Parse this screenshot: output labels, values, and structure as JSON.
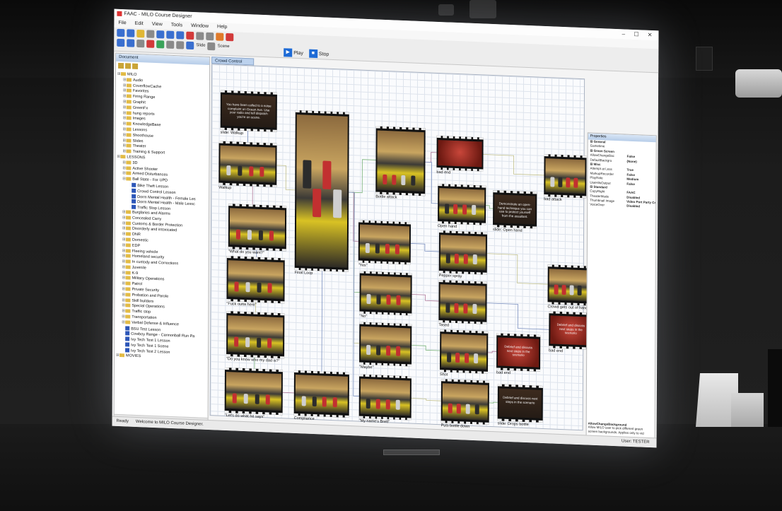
{
  "window": {
    "title": "FAAC - MILO Course Designer",
    "controls": [
      "–",
      "☐",
      "✕"
    ]
  },
  "menu": [
    "File",
    "Edit",
    "View",
    "Tools",
    "Window",
    "Help"
  ],
  "toolbar": {
    "slide_label": "Slide",
    "scene_label": "Scene",
    "play_label": "Play",
    "stop_label": "Stop"
  },
  "document": {
    "header": "Document",
    "tree": [
      {
        "depth": 0,
        "type": "folder",
        "label": "MILO"
      },
      {
        "depth": 1,
        "type": "folder",
        "label": "Audio"
      },
      {
        "depth": 1,
        "type": "folder",
        "label": "CoverflowCache"
      },
      {
        "depth": 1,
        "type": "folder",
        "label": "Favorites"
      },
      {
        "depth": 1,
        "type": "folder",
        "label": "Firing Range"
      },
      {
        "depth": 1,
        "type": "folder",
        "label": "Graphit"
      },
      {
        "depth": 1,
        "type": "folder",
        "label": "GreenFx"
      },
      {
        "depth": 1,
        "type": "folder",
        "label": "hung reports"
      },
      {
        "depth": 1,
        "type": "folder",
        "label": "Images"
      },
      {
        "depth": 1,
        "type": "folder",
        "label": "KnowledgeBase"
      },
      {
        "depth": 1,
        "type": "folder",
        "label": "Lessons"
      },
      {
        "depth": 1,
        "type": "folder",
        "label": "Shoothouse"
      },
      {
        "depth": 1,
        "type": "folder",
        "label": "Slides"
      },
      {
        "depth": 1,
        "type": "folder",
        "label": "Theater"
      },
      {
        "depth": 1,
        "type": "folder",
        "label": "Training & Support"
      },
      {
        "depth": 0,
        "type": "folder",
        "label": "LESSONS"
      },
      {
        "depth": 1,
        "type": "folder",
        "label": "3D"
      },
      {
        "depth": 1,
        "type": "folder",
        "label": "Active Shooter"
      },
      {
        "depth": 1,
        "type": "folder",
        "label": "Armed Disturbances"
      },
      {
        "depth": 1,
        "type": "folder",
        "label": "Ball State - For UPD"
      },
      {
        "depth": 2,
        "type": "lesson",
        "label": "Bike Theft Lesson"
      },
      {
        "depth": 2,
        "type": "lesson",
        "label": "Crowd Control Lesson"
      },
      {
        "depth": 2,
        "type": "lesson",
        "label": "Dorm Mental Health - Female Les"
      },
      {
        "depth": 2,
        "type": "lesson",
        "label": "Dorm Mental Health - Male Lessc"
      },
      {
        "depth": 2,
        "type": "lesson",
        "label": "Traffic Stop Lesson"
      },
      {
        "depth": 1,
        "type": "folder",
        "label": "Burglaries and Alarms"
      },
      {
        "depth": 1,
        "type": "folder",
        "label": "Concealed Carry"
      },
      {
        "depth": 1,
        "type": "folder",
        "label": "Customs & Border Protection"
      },
      {
        "depth": 1,
        "type": "folder",
        "label": "Disorderly and intoxicated"
      },
      {
        "depth": 1,
        "type": "folder",
        "label": "DNR"
      },
      {
        "depth": 1,
        "type": "folder",
        "label": "Domestic"
      },
      {
        "depth": 1,
        "type": "folder",
        "label": "EDP"
      },
      {
        "depth": 1,
        "type": "folder",
        "label": "Fleeing vehicle"
      },
      {
        "depth": 1,
        "type": "folder",
        "label": "Homeland security"
      },
      {
        "depth": 1,
        "type": "folder",
        "label": "In custody and Corrections"
      },
      {
        "depth": 1,
        "type": "folder",
        "label": "Juvenile"
      },
      {
        "depth": 1,
        "type": "folder",
        "label": "K-9"
      },
      {
        "depth": 1,
        "type": "folder",
        "label": "Military Operations"
      },
      {
        "depth": 1,
        "type": "folder",
        "label": "Patrol"
      },
      {
        "depth": 1,
        "type": "folder",
        "label": "Private Security"
      },
      {
        "depth": 1,
        "type": "folder",
        "label": "Probation and Parole"
      },
      {
        "depth": 1,
        "type": "folder",
        "label": "Skill builders"
      },
      {
        "depth": 1,
        "type": "folder",
        "label": "Special Operations"
      },
      {
        "depth": 1,
        "type": "folder",
        "label": "Traffic stop"
      },
      {
        "depth": 1,
        "type": "folder",
        "label": "Transportation"
      },
      {
        "depth": 1,
        "type": "folder",
        "label": "Verbal Defense & Influence"
      },
      {
        "depth": 1,
        "type": "lesson",
        "label": "BSU Test Lesson"
      },
      {
        "depth": 1,
        "type": "lesson",
        "label": "Cowboy Range - Cannonball Run Pa"
      },
      {
        "depth": 1,
        "type": "lesson",
        "label": "Ivy Tech Test 1 Lesson"
      },
      {
        "depth": 1,
        "type": "lesson",
        "label": "Ivy Tech Test 1 Scene"
      },
      {
        "depth": 1,
        "type": "lesson",
        "label": "Ivy Tech Test 2 Lesson"
      },
      {
        "depth": 0,
        "type": "folder",
        "label": "MOVIES"
      }
    ]
  },
  "canvas": {
    "tab": "Crowd Control",
    "nodes": [
      {
        "id": "n1",
        "kind": "slide",
        "caption": "slide: Walkup",
        "text": "You have been called to a noise complaint on Ocean Ave. Use your radio and tell dispatch you're on scene."
      },
      {
        "id": "n2",
        "kind": "video",
        "caption": "Walkup"
      },
      {
        "id": "n3",
        "kind": "tall",
        "caption": "Final Loop"
      },
      {
        "id": "n4",
        "kind": "video",
        "caption": "Bottle attack"
      },
      {
        "id": "n5",
        "kind": "red",
        "caption": "bad end"
      },
      {
        "id": "n6",
        "kind": "video",
        "caption": "bad attack"
      },
      {
        "id": "n7",
        "kind": "video",
        "caption": "Open hand"
      },
      {
        "id": "n8",
        "kind": "slide",
        "caption": "slide: Open hand",
        "text": "Demonstrate an open-hand technique you can use to protect yourself from the assailant."
      },
      {
        "id": "n9",
        "kind": "video",
        "caption": "\"What do you want?\""
      },
      {
        "id": "n10",
        "kind": "video",
        "caption": "\"Yes\""
      },
      {
        "id": "n11",
        "kind": "video",
        "caption": "Pepper spray"
      },
      {
        "id": "n12",
        "kind": "video",
        "caption": "Crowd gets out of hand"
      },
      {
        "id": "n13",
        "kind": "video",
        "caption": "\"Fuck outta here\""
      },
      {
        "id": "n14",
        "kind": "video",
        "caption": "\"No\""
      },
      {
        "id": "n15",
        "kind": "video",
        "caption": "Tased"
      },
      {
        "id": "n16",
        "kind": "red",
        "caption": "bad end",
        "text": "Debrief and discuss next steps in the scenario"
      },
      {
        "id": "n17",
        "kind": "video",
        "caption": "\"Do you know who my dad is?\""
      },
      {
        "id": "n18",
        "kind": "video",
        "caption": "\"Maybe\""
      },
      {
        "id": "n19",
        "kind": "video",
        "caption": "Shot"
      },
      {
        "id": "n20",
        "kind": "red",
        "caption": "bad end",
        "text": "Debrief and discuss next steps in the scenario"
      },
      {
        "id": "n21",
        "kind": "video",
        "caption": "\"Let's do what he says\""
      },
      {
        "id": "n22",
        "kind": "video",
        "caption": "Compliance"
      },
      {
        "id": "n23",
        "kind": "video",
        "caption": "\"My name's Brett\""
      },
      {
        "id": "n24",
        "kind": "video",
        "caption": "Puts bottle down"
      },
      {
        "id": "n25",
        "kind": "slide",
        "caption": "slide: Drops bottle",
        "text": "Debrief and discuss next steps in the scenario"
      }
    ]
  },
  "properties": {
    "header": "Properties",
    "rows": [
      {
        "cat": true,
        "k": "General",
        "v": ""
      },
      {
        "cat": false,
        "k": "Gametime",
        "v": ""
      },
      {
        "cat": true,
        "k": "Green Screen",
        "v": ""
      },
      {
        "cat": false,
        "k": "AllowChangeBac",
        "v": "False"
      },
      {
        "cat": false,
        "k": "DefaultBackgro",
        "v": "(None)"
      },
      {
        "cat": true,
        "k": "Misc",
        "v": ""
      },
      {
        "cat": false,
        "k": "Attempt at Less",
        "v": "True"
      },
      {
        "cat": false,
        "k": "MarkupRecorder",
        "v": "False"
      },
      {
        "cat": false,
        "k": "PlayRate",
        "v": "Medium"
      },
      {
        "cat": false,
        "k": "UseHitsOutput",
        "v": "False"
      },
      {
        "cat": true,
        "k": "Standard",
        "v": ""
      },
      {
        "cat": false,
        "k": "CopyRight",
        "v": "FAAC"
      },
      {
        "cat": false,
        "k": "TheaterMode",
        "v": "Disabled"
      },
      {
        "cat": false,
        "k": "Thumbnail Image",
        "v": "Video Port Party Cr"
      },
      {
        "cat": false,
        "k": "VoiceOver",
        "v": "Disabled"
      }
    ],
    "desc_title": "AllowChangeBackground",
    "desc_text": "Allow MILO user to pick different green screen backgrounds. Applies only to vid"
  },
  "status": {
    "left": "Ready",
    "message": "Welcome to MILO Course Designer.",
    "right": "User: TESTER"
  }
}
